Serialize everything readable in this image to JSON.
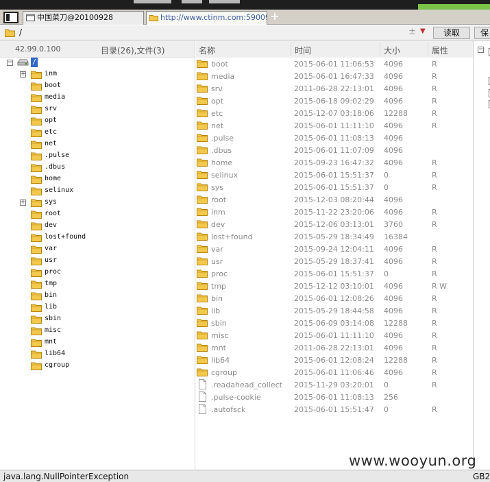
{
  "tabs": [
    {
      "label": "中国菜刀@20100928"
    },
    {
      "label": "http://www.ctinm.com:59009..."
    }
  ],
  "new_tab_label": "+",
  "address_bar": {
    "path": "/",
    "plus_symbol": "±",
    "read_button": "读取",
    "save_button": "保"
  },
  "left_panel": {
    "ip": "42.99.0.100",
    "dir_count": "目录(26),文件(3)",
    "root_label": "/",
    "tree_items": [
      {
        "name": "inm",
        "expander": "+"
      },
      {
        "name": "boot"
      },
      {
        "name": "media"
      },
      {
        "name": "srv"
      },
      {
        "name": "opt"
      },
      {
        "name": "etc"
      },
      {
        "name": "net"
      },
      {
        "name": ".pulse"
      },
      {
        "name": ".dbus"
      },
      {
        "name": "home"
      },
      {
        "name": "selinux"
      },
      {
        "name": "sys",
        "expander": "+"
      },
      {
        "name": "root"
      },
      {
        "name": "dev"
      },
      {
        "name": "lost+found"
      },
      {
        "name": "var"
      },
      {
        "name": "usr"
      },
      {
        "name": "proc"
      },
      {
        "name": "tmp"
      },
      {
        "name": "bin"
      },
      {
        "name": "lib"
      },
      {
        "name": "sbin"
      },
      {
        "name": "misc"
      },
      {
        "name": "mnt"
      },
      {
        "name": "lib64"
      },
      {
        "name": "cgroup"
      }
    ]
  },
  "file_list": {
    "columns": {
      "name": "名称",
      "time": "时间",
      "size": "大小",
      "attr": "属性"
    },
    "rows": [
      {
        "type": "folder",
        "name": "boot",
        "time": "2015-06-01 11:06:53",
        "size": "4096",
        "attr": "R"
      },
      {
        "type": "folder",
        "name": "media",
        "time": "2015-06-01 16:47:33",
        "size": "4096",
        "attr": "R"
      },
      {
        "type": "folder",
        "name": "srv",
        "time": "2011-06-28 22:13:01",
        "size": "4096",
        "attr": "R"
      },
      {
        "type": "folder",
        "name": "opt",
        "time": "2015-06-18 09:02:29",
        "size": "4096",
        "attr": "R"
      },
      {
        "type": "folder",
        "name": "etc",
        "time": "2015-12-07 03:18:06",
        "size": "12288",
        "attr": "R"
      },
      {
        "type": "folder",
        "name": "net",
        "time": "2015-06-01 11:11:10",
        "size": "4096",
        "attr": "R"
      },
      {
        "type": "folder",
        "name": ".pulse",
        "time": "2015-06-01 11:08:13",
        "size": "4096",
        "attr": ""
      },
      {
        "type": "folder",
        "name": ".dbus",
        "time": "2015-06-01 11:07:09",
        "size": "4096",
        "attr": ""
      },
      {
        "type": "folder",
        "name": "home",
        "time": "2015-09-23 16:47:32",
        "size": "4096",
        "attr": "R"
      },
      {
        "type": "folder",
        "name": "selinux",
        "time": "2015-06-01 15:51:37",
        "size": "0",
        "attr": "R"
      },
      {
        "type": "folder",
        "name": "sys",
        "time": "2015-06-01 15:51:37",
        "size": "0",
        "attr": "R"
      },
      {
        "type": "folder",
        "name": "root",
        "time": "2015-12-03 08:20:44",
        "size": "4096",
        "attr": ""
      },
      {
        "type": "folder",
        "name": "inm",
        "time": "2015-11-22 23:20:06",
        "size": "4096",
        "attr": "R"
      },
      {
        "type": "folder",
        "name": "dev",
        "time": "2015-12-06 03:13:01",
        "size": "3760",
        "attr": "R"
      },
      {
        "type": "folder",
        "name": "lost+found",
        "time": "2015-05-29 18:34:49",
        "size": "16384",
        "attr": ""
      },
      {
        "type": "folder",
        "name": "var",
        "time": "2015-09-24 12:04:11",
        "size": "4096",
        "attr": "R"
      },
      {
        "type": "folder",
        "name": "usr",
        "time": "2015-05-29 18:37:41",
        "size": "4096",
        "attr": "R"
      },
      {
        "type": "folder",
        "name": "proc",
        "time": "2015-06-01 15:51:37",
        "size": "0",
        "attr": "R"
      },
      {
        "type": "folder",
        "name": "tmp",
        "time": "2015-12-12 03:10:01",
        "size": "4096",
        "attr": "R W"
      },
      {
        "type": "folder",
        "name": "bin",
        "time": "2015-06-01 12:08:26",
        "size": "4096",
        "attr": "R"
      },
      {
        "type": "folder",
        "name": "lib",
        "time": "2015-05-29 18:44:58",
        "size": "4096",
        "attr": "R"
      },
      {
        "type": "folder",
        "name": "sbin",
        "time": "2015-06-09 03:14:08",
        "size": "12288",
        "attr": "R"
      },
      {
        "type": "folder",
        "name": "misc",
        "time": "2015-06-01 11:11:10",
        "size": "4096",
        "attr": "R"
      },
      {
        "type": "folder",
        "name": "mnt",
        "time": "2011-06-28 22:13:01",
        "size": "4096",
        "attr": "R"
      },
      {
        "type": "folder",
        "name": "lib64",
        "time": "2015-06-01 12:08:24",
        "size": "12288",
        "attr": "R"
      },
      {
        "type": "folder",
        "name": "cgroup",
        "time": "2015-06-01 11:06:46",
        "size": "4096",
        "attr": "R"
      },
      {
        "type": "file",
        "name": ".readahead_collect",
        "time": "2015-11-29 03:20:01",
        "size": "0",
        "attr": "R"
      },
      {
        "type": "file",
        "name": ".pulse-cookie",
        "time": "2015-06-01 11:08:13",
        "size": "256",
        "attr": ""
      },
      {
        "type": "file",
        "name": ".autofsck",
        "time": "2015-06-01 15:51:47",
        "size": "0",
        "attr": "R"
      }
    ]
  },
  "right_panel": {
    "expander": "−"
  },
  "status_bar": {
    "message": "java.lang.NullPointerException",
    "encoding": "GB2"
  },
  "watermark": "www.wooyun.org",
  "colors": {
    "folder_fill": "#f2c94c",
    "folder_edge": "#b8860b",
    "selection": "#3168c8",
    "list_text": "#8a8a8a"
  }
}
